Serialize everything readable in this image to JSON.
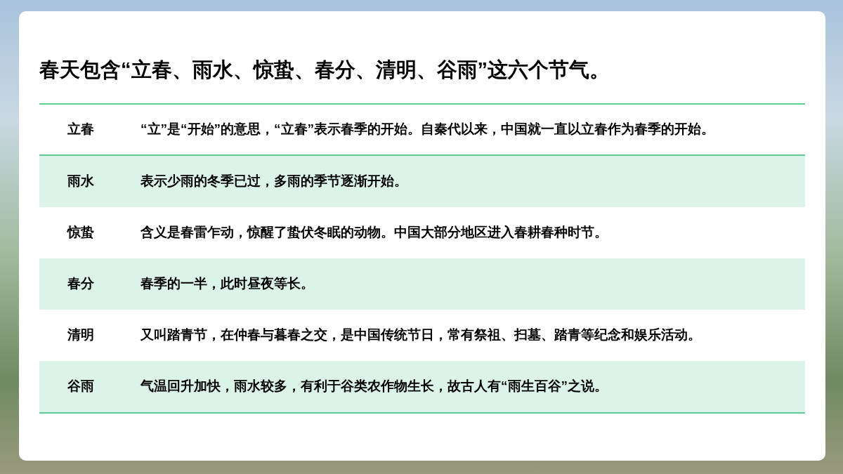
{
  "title": "春天包含“立春、雨水、惊蛰、春分、清明、谷雨”这六个节气。",
  "table": {
    "rows": [
      {
        "term": "立春",
        "description": "“立”是“开始”的意思，“立春”表示春季的开始。自秦代以来，中国就一直以立春作为春季的开始。"
      },
      {
        "term": "雨水",
        "description": "表示少雨的冬季已过，多雨的季节逐渐开始。"
      },
      {
        "term": "惊蛰",
        "description": "含义是春雷乍动，惊醒了蛰伏冬眠的动物。中国大部分地区进入春耕春种时节。"
      },
      {
        "term": "春分",
        "description": "春季的一半，此时昼夜等长。"
      },
      {
        "term": "清明",
        "description": "又叫踏青节，在仲春与暮春之交，是中国传统节日，常有祭祖、扫墓、踏青等纪念和娱乐活动。"
      },
      {
        "term": "谷雨",
        "description": "气温回升加快，雨水较多，有利于谷类农作物生长，故古人有“雨生百谷”之说。"
      }
    ]
  }
}
